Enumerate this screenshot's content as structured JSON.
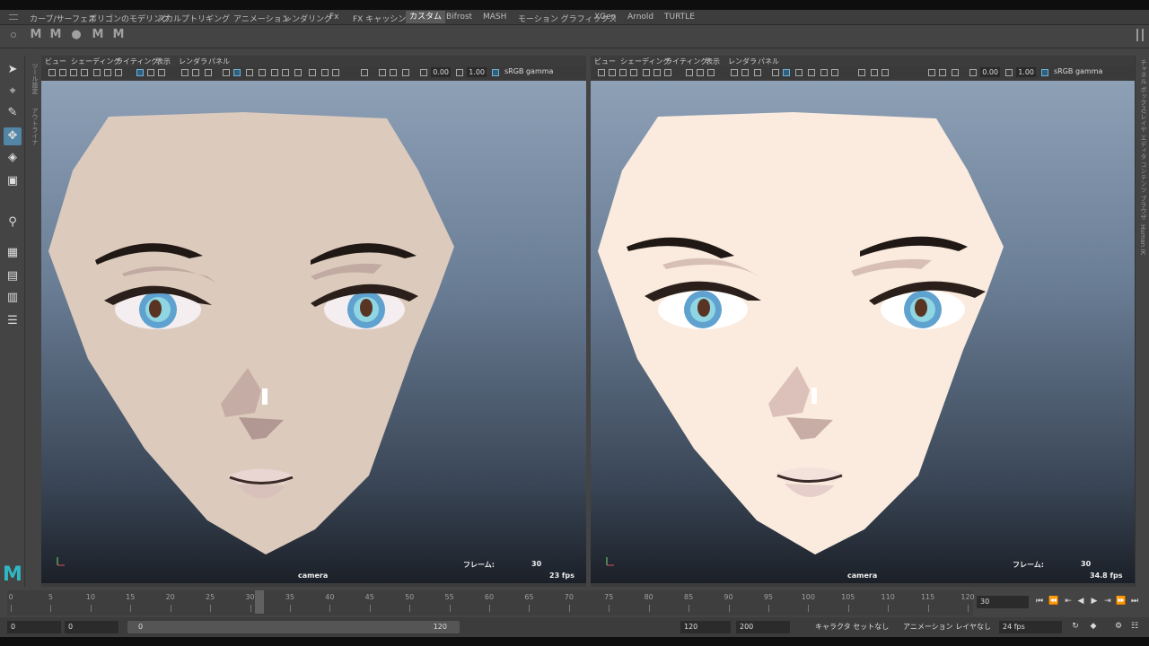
{
  "shelf_tabs": [
    "カーブ/サーフェス",
    "ポリゴンのモデリング",
    "スカルプト",
    "リギング",
    "アニメーション",
    "レンダリング",
    "Fx",
    "FX キャッシング",
    "カスタム",
    "Bifrost",
    "MASH",
    "モーション グラフィックス",
    "XGen",
    "Arnold",
    "TURTLE"
  ],
  "active_tab": "カスタム",
  "shelf_icons": [
    "M",
    "M",
    "●",
    "M",
    "M"
  ],
  "side_labels": {
    "tool_settings": "ツール設定",
    "outliner": "アウトライナ"
  },
  "right_labels": [
    "チャネル ボックス/レイヤ エディタ",
    "コンテンツ ブラウザ",
    "Human IK"
  ],
  "panels": [
    {
      "menu": [
        "ビュー",
        "シェーディング",
        "ライティング",
        "表示",
        "レンダラ",
        "パネル"
      ],
      "exposure": "0.00",
      "gamma": "1.00",
      "colorspace": "sRGB gamma",
      "frame_label": "フレーム:",
      "frame_value": "30",
      "camera": "camera",
      "fps": "23 fps",
      "skin_color": "#dccabd"
    },
    {
      "menu": [
        "ビュー",
        "シェーディング",
        "ライティング",
        "表示",
        "レンダラ",
        "パネル"
      ],
      "exposure": "0.00",
      "gamma": "1.00",
      "colorspace": "sRGB gamma",
      "frame_label": "フレーム:",
      "frame_value": "30",
      "camera": "camera",
      "fps": "34.8 fps",
      "skin_color": "#fbebde"
    }
  ],
  "timeline": {
    "ticks": [
      "0",
      "5",
      "10",
      "15",
      "20",
      "25",
      "30",
      "35",
      "40",
      "45",
      "50",
      "55",
      "60",
      "65",
      "70",
      "75",
      "80",
      "85",
      "90",
      "95",
      "100",
      "105",
      "110",
      "115",
      "120"
    ],
    "current_frame": "30"
  },
  "range": {
    "start": "0",
    "playback_start": "0",
    "slider_start": "0",
    "slider_end": "120",
    "playback_end": "120",
    "end": "200",
    "character_set": "キャラクタ セットなし",
    "anim_layer": "アニメーション レイヤなし",
    "fps": "24 fps"
  }
}
